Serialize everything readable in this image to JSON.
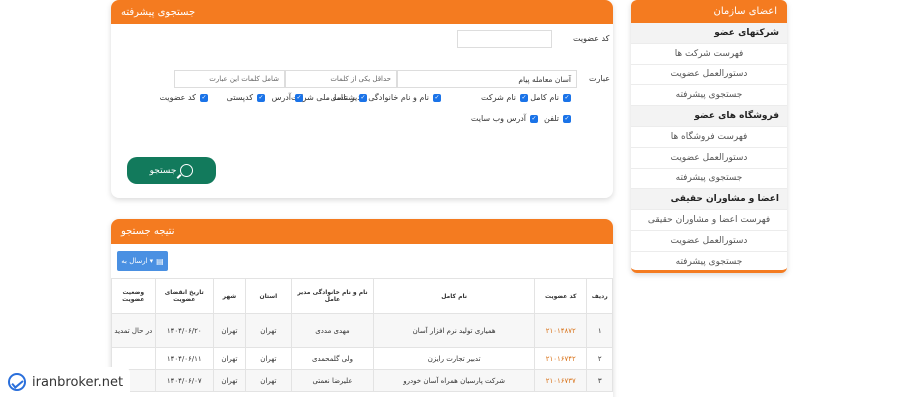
{
  "sidebar": {
    "title": "اعضای سازمان",
    "items": [
      {
        "label": "شرکتهای عضو",
        "type": "group"
      },
      {
        "label": "فهرست شرکت ها",
        "type": "link"
      },
      {
        "label": "دستورالعمل عضویت",
        "type": "link"
      },
      {
        "label": "جستجوی پیشرفته",
        "type": "link"
      },
      {
        "label": "فروشگاه های عضو",
        "type": "group"
      },
      {
        "label": "فهرست فروشگاه ها",
        "type": "link"
      },
      {
        "label": "دستورالعمل عضویت",
        "type": "link"
      },
      {
        "label": "جستجوی پیشرفته",
        "type": "link"
      },
      {
        "label": "اعضا و مشاوران حقیقی",
        "type": "group"
      },
      {
        "label": "فهرست اعضا و مشاوران حقیقی",
        "type": "link"
      },
      {
        "label": "دستورالعمل عضویت",
        "type": "link"
      },
      {
        "label": "جستجوی پیشرفته",
        "type": "link"
      }
    ]
  },
  "search": {
    "title": "جستجوی پیشرفته",
    "member_code_label": "کد عضویت",
    "member_code_value": "",
    "phrase_label": "عبارت",
    "phrase_value": "آسان معامله پیام",
    "min_one_placeholder": "حداقل یکی از کلمات",
    "exclude_placeholder": "شامل کلمات این عبارت",
    "checkboxes": [
      {
        "label": "نام کامل",
        "checked": true
      },
      {
        "label": "نام شرکت",
        "checked": true
      },
      {
        "label": "نام و نام خانوادگی مدیر عامل",
        "checked": true
      },
      {
        "label": "شناسه ملی شرکت",
        "checked": true
      },
      {
        "label": "آدرس",
        "checked": true
      },
      {
        "label": "کدپستی",
        "checked": true
      },
      {
        "label": "کد عضویت",
        "checked": true
      },
      {
        "label": "تلفن",
        "checked": true
      },
      {
        "label": "آدرس وب سایت",
        "checked": true
      }
    ],
    "search_button": "جستجو"
  },
  "results": {
    "title": "نتیجه جستجو",
    "send_button": "ارسال به",
    "columns": [
      "ردیف",
      "کد عضویت",
      "نام کامل",
      "نام و نام خانوادگی مدیر عامل",
      "استان",
      "شهر",
      "تاریخ انقضای عضویت",
      "وضعیت عضویت"
    ],
    "rows": [
      [
        "۱",
        "۲۱۰۱۴۸۷۲",
        "همیاری تولید نرم افزار آسان",
        "مهدی مددی",
        "تهران",
        "تهران",
        "۱۴۰۴/۰۶/۲۰",
        "در حال تمدید"
      ],
      [
        "۲",
        "۲۱۰۱۶۷۴۲",
        "تدبیر تجارت رایزن",
        "ولی گلمحمدی",
        "تهران",
        "تهران",
        "۱۴۰۴/۰۶/۱۱",
        ""
      ],
      [
        "۳",
        "۲۱۰۱۶۷۳۷",
        "شرکت پارسیان همراه آسان خودرو",
        "علیرضا نعمتی",
        "تهران",
        "تهران",
        "۱۴۰۴/۰۶/۰۷",
        ""
      ]
    ]
  },
  "watermark": {
    "text": "iranbroker.net"
  },
  "colors": {
    "accent": "#f47b20",
    "button": "#127a5c",
    "send": "#4a90e2",
    "code": "#d9731a"
  }
}
